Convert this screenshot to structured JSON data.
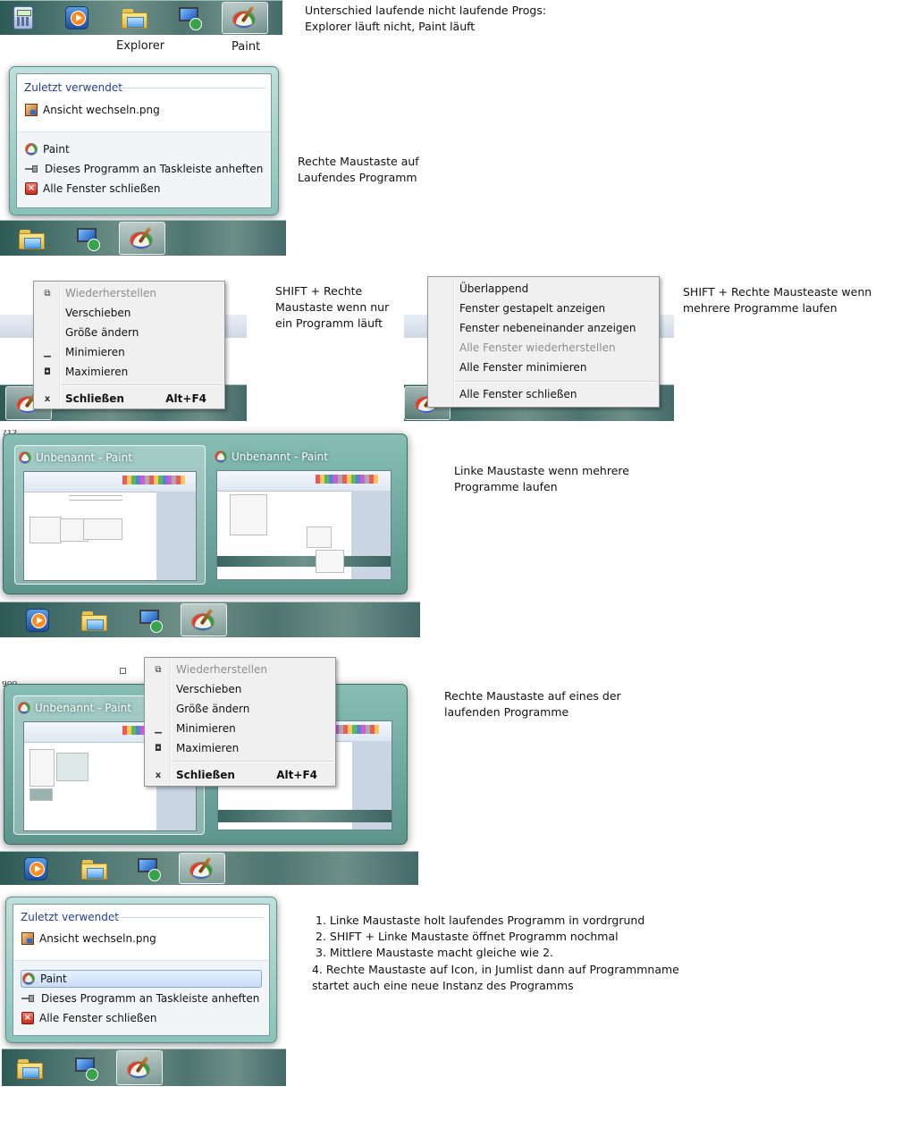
{
  "panel1": {
    "labels": [
      "Explorer",
      "Paint"
    ],
    "icons": [
      "calculator-icon",
      "media-player-icon",
      "explorer-folder-icon",
      "remote-desktop-icon",
      "paint-icon"
    ],
    "note": "Unterschied laufende nicht laufende Progs:\nExplorer läuft nicht, Paint läuft"
  },
  "jumplist1": {
    "header": "Zuletzt verwendet",
    "recent_file": "Ansicht wechseln.png",
    "tasks": [
      "Paint",
      "Dieses Programm an Taskleiste anheften",
      "Alle Fenster schließen"
    ],
    "note": "Rechte Maustaste auf\nLaufendes Programm"
  },
  "sysmenu1": {
    "items": [
      "Wiederherstellen",
      "Verschieben",
      "Größe ändern",
      "Minimieren",
      "Maximieren",
      "Schließen"
    ],
    "shortcut": "Alt+F4",
    "note": "SHIFT + Rechte\nMaustaste wenn nur\nein Programm läuft"
  },
  "groupmenu": {
    "items": [
      "Überlappend",
      "Fenster gestapelt anzeigen",
      "Fenster nebeneinander anzeigen",
      "Alle Fenster wiederherstellen",
      "Alle Fenster minimieren",
      "Alle Fenster schließen"
    ],
    "note": "SHIFT + Rechte Mausteaste wenn\nmehrere Programme laufen"
  },
  "thumbs1": {
    "titles": [
      "Unbenannt - Paint",
      "Unbenannt - Paint"
    ],
    "edge_text": "712",
    "note": "Linke Maustaste wenn mehrere\nProgramme laufen"
  },
  "thumbs2": {
    "title": "Unbenannt - Paint",
    "edge_text": "900",
    "menu_items": [
      "Wiederherstellen",
      "Verschieben",
      "Größe ändern",
      "Minimieren",
      "Maximieren",
      "Schließen"
    ],
    "shortcut": "Alt+F4",
    "note": "Rechte Maustaste auf eines der\nlaufenden Programme"
  },
  "jumplist2": {
    "header": "Zuletzt verwendet",
    "recent_file": "Ansicht wechseln.png",
    "tasks": [
      "Paint",
      "Dieses Programm an Taskleiste anheften",
      "Alle Fenster schließen"
    ],
    "notes": [
      "1. Linke Maustaste holt laufendes Programm in vordrgrund",
      "2. SHIFT + Linke Maustaste öffnet Programm nochmal",
      "3. Mittlere Maustaste macht gleiche wie 2.",
      "4. Rechte Maustaste auf Icon, in Jumlist dann auf Programmname",
      "startet auch eine neue Instanz des Programms"
    ]
  },
  "colors": {
    "menu_text_blue": "#1f3d9a",
    "disabled_gray": "#8d8d8d",
    "taskbar_teal": "#527a74"
  }
}
